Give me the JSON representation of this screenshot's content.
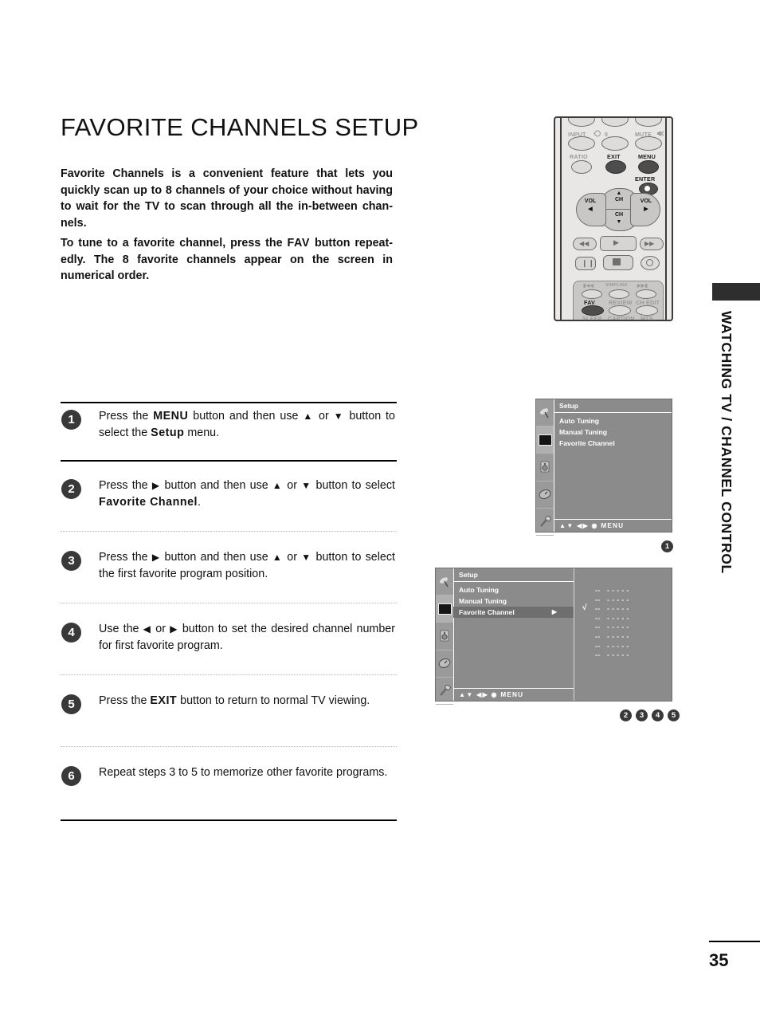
{
  "page": {
    "title": "FAVORITE CHANNELS SETUP",
    "number": "35",
    "side_label": "WATCHING TV / CHANNEL CONTROL"
  },
  "intro": {
    "p1": "Favorite Channels is a convenient feature that lets you quickly scan up to 8 channels of your choice without having to wait for the TV to scan through all the in-between chan-nels.",
    "p2_pre": "To tune to a favorite channel, press the ",
    "p2_kbd": "FAV",
    "p2_post": " button repeat-edly. The 8 favorite channels appear on the screen in numerical order."
  },
  "steps": [
    {
      "num": "1",
      "parts": [
        {
          "t": "Press the ",
          "b": false
        },
        {
          "t": "MENU",
          "b": true
        },
        {
          "t": " button and then use ",
          "b": false
        },
        {
          "t": "▲",
          "b": false
        },
        {
          "t": " or ",
          "b": false
        },
        {
          "t": "▼",
          "b": false
        },
        {
          "t": " button to select the ",
          "b": false
        },
        {
          "t": "Setup",
          "b": true
        },
        {
          "t": " menu.",
          "b": false
        }
      ]
    },
    {
      "num": "2",
      "parts": [
        {
          "t": "Press the ",
          "b": false
        },
        {
          "t": "▶",
          "b": false
        },
        {
          "t": " button and then use ",
          "b": false
        },
        {
          "t": "▲",
          "b": false
        },
        {
          "t": " or ",
          "b": false
        },
        {
          "t": "▼",
          "b": false
        },
        {
          "t": " button to select ",
          "b": false
        },
        {
          "t": "Favorite Channel",
          "b": true
        },
        {
          "t": ".",
          "b": false
        }
      ]
    },
    {
      "num": "3",
      "parts": [
        {
          "t": "Press the ",
          "b": false
        },
        {
          "t": "▶",
          "b": false
        },
        {
          "t": " button and then use ",
          "b": false
        },
        {
          "t": "▲",
          "b": false
        },
        {
          "t": " or ",
          "b": false
        },
        {
          "t": "▼",
          "b": false
        },
        {
          "t": " button to select the first favorite program position.",
          "b": false
        }
      ]
    },
    {
      "num": "4",
      "parts": [
        {
          "t": "Use the ",
          "b": false
        },
        {
          "t": "◀",
          "b": false
        },
        {
          "t": " or ",
          "b": false
        },
        {
          "t": "▶",
          "b": false
        },
        {
          "t": "  button to set the desired channel number for first favorite program.",
          "b": false
        }
      ]
    },
    {
      "num": "5",
      "parts": [
        {
          "t": "Press the ",
          "b": false
        },
        {
          "t": "EXIT",
          "b": true
        },
        {
          "t": " button to return to normal TV viewing.",
          "b": false
        }
      ]
    },
    {
      "num": "6",
      "parts": [
        {
          "t": "Repeat steps 3 to 5 to memorize other favorite programs.",
          "b": false
        }
      ]
    }
  ],
  "remote": {
    "labels": {
      "input": "INPUT",
      "zero": "0",
      "mute": "MUTE",
      "ratio": "RATIO",
      "exit": "EXIT",
      "menu": "MENU",
      "enter": "ENTER",
      "ch": "CH",
      "vol": "VOL",
      "fav": "FAV",
      "review": "REVIEW",
      "ch_edit": "CH EDIT",
      "sleep": "SLEEP",
      "caption": "CAPTION",
      "mts": "MTS",
      "simplink": "SIMPLINK"
    },
    "highlighted": [
      "EXIT",
      "MENU",
      "ENTER",
      "FAV"
    ]
  },
  "osd1": {
    "title": "Setup",
    "items": [
      "Auto Tuning",
      "Manual Tuning",
      "Favorite Channel"
    ],
    "footer": "▲▼  ◀▶   ◉   MENU",
    "marker": "1",
    "icons": [
      "antenna-icon",
      "screen-icon",
      "audio-icon",
      "timer-icon",
      "tools-icon"
    ],
    "selected_icon_index": 1
  },
  "osd2": {
    "title": "Setup",
    "items": [
      "Auto Tuning",
      "Manual Tuning",
      "Favorite Channel"
    ],
    "highlighted_item": "Favorite Channel",
    "submenu_arrow": "▶",
    "footer": "▲▼  ◀▶   ◉   MENU",
    "fav_rows": [
      {
        "label": "--   - - - - -",
        "checked": false
      },
      {
        "label": "--   - - - - -",
        "checked": false
      },
      {
        "label": "--   - - - - -",
        "checked": true
      },
      {
        "label": "--   - - - - -",
        "checked": false
      },
      {
        "label": "--   - - - - -",
        "checked": false
      },
      {
        "label": "--   - - - - -",
        "checked": false
      },
      {
        "label": "--   - - - - -",
        "checked": false
      },
      {
        "label": "--   - - - - -",
        "checked": false
      }
    ],
    "check_glyph": "√",
    "markers": [
      "2",
      "3",
      "4",
      "5"
    ],
    "icons": [
      "antenna-icon",
      "screen-icon",
      "audio-icon",
      "timer-icon",
      "tools-icon"
    ],
    "selected_icon_index": 1
  },
  "colors": {
    "badge": "#39393a",
    "osd_bg": "#8b8b8b",
    "osd_highlight": "#6f6f6f",
    "side_tab": "#2e2e2e"
  }
}
